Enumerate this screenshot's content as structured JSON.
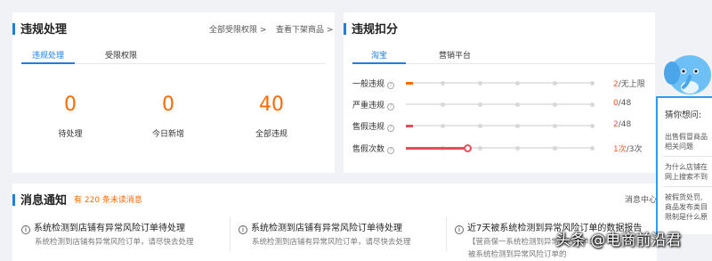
{
  "violation": {
    "title": "违规处理",
    "links": [
      "全部受限权限 >",
      "查看下架商品 >"
    ],
    "tabs": [
      "违规处理",
      "受限权限"
    ],
    "stats": [
      {
        "value": "0",
        "label": "待处理"
      },
      {
        "value": "0",
        "label": "今日新增"
      },
      {
        "value": "40",
        "label": "全部违规"
      }
    ]
  },
  "deduction": {
    "title": "违规扣分",
    "tabs": [
      "淘宝",
      "营销平台"
    ],
    "rows": [
      {
        "label": "一般违规",
        "current": "2",
        "total": "/无上限",
        "progress": 0.02,
        "color": "#ff6a00"
      },
      {
        "label": "严重违规",
        "current": "0",
        "total": "/48",
        "progress": 0.0,
        "color": "#e84c5a"
      },
      {
        "label": "售假违规",
        "current": "2",
        "total": "/48",
        "progress": 0.04,
        "color": "#e84c5a"
      },
      {
        "label": "售假次数",
        "current": "1次",
        "total": "/3次",
        "progress": 0.33,
        "color": "#e84c5a"
      }
    ]
  },
  "messages": {
    "title": "消息通知",
    "unread": "有 220 条未读消息",
    "center_link": "消息中心",
    "items": [
      {
        "title": "系统检测到店铺有异常风险订单待处理",
        "sub": "系统检测到店铺有异常风险订单，请尽快去处理"
      },
      {
        "title": "系统检测到店铺有异常风险订单待处理",
        "sub": "系统检测到店铺有异常风险订单，请尽快去处理"
      },
      {
        "title": "近7天被系统检测到异常风险订单的数据报告",
        "sub": "【营商保一系统检测到异常风险订单的",
        "sub2": "被系统检测到异常风险订单的"
      }
    ]
  },
  "side_help": {
    "heading": "猜你想问:",
    "items": [
      [
        "出售假冒商品",
        "相关问题"
      ],
      [
        "为什么店铺在",
        "网上搜索不到"
      ],
      [
        "被假货处罚,",
        "商品发布类目",
        "限制是什么原"
      ]
    ]
  },
  "watermark": "头条 @电商前沿君",
  "colors": {
    "accent": "#1f7fe0",
    "orange": "#ff6a00",
    "red": "#e84c5a"
  }
}
